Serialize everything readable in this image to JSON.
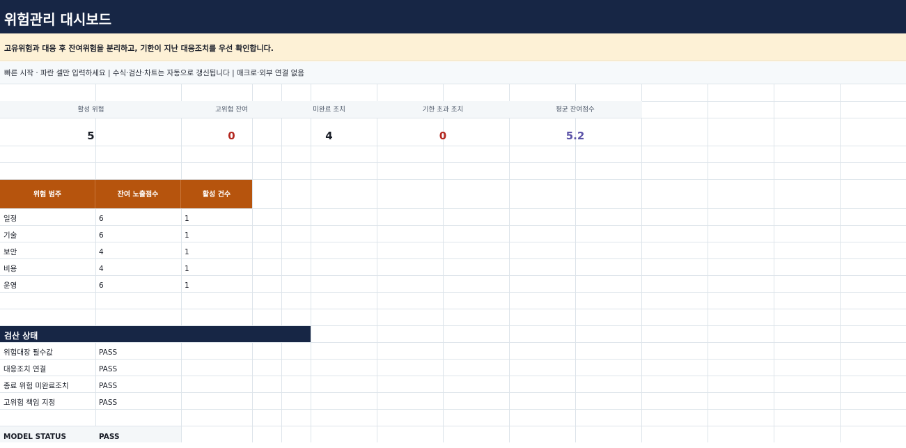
{
  "title": "위험관리 대시보드",
  "note": "고유위험과 대응 후 잔여위험을 분리하고, 기한이 지난 대응조치를 우선 확인합니다.",
  "quick_start": "빠른 시작 · 파란 셀만 입력하세요  |  수식·검산·차트는 자동으로 갱신됩니다  |  매크로·외부 연결 없음",
  "kpis": [
    {
      "label": "활성 위험",
      "value": "5",
      "color": "#1b1f29"
    },
    {
      "label": "고위험 잔여",
      "value": "0",
      "color": "#b3261e"
    },
    {
      "label": "미완료 조치",
      "value": "4",
      "color": "#1b1f29"
    },
    {
      "label": "기한 초과 조치",
      "value": "0",
      "color": "#b3261e"
    },
    {
      "label": "평균 잔여점수",
      "value": "5.2",
      "color": "#5b53a8"
    }
  ],
  "category_table": {
    "headers": [
      "위험 범주",
      "잔여 노출점수",
      "활성 건수"
    ],
    "rows": [
      [
        "일정",
        "6",
        "1"
      ],
      [
        "기술",
        "6",
        "1"
      ],
      [
        "보안",
        "4",
        "1"
      ],
      [
        "비용",
        "4",
        "1"
      ],
      [
        "운영",
        "6",
        "1"
      ]
    ]
  },
  "checks": {
    "title": "검산 상태",
    "rows": [
      [
        "위험대장 필수값",
        "PASS"
      ],
      [
        "대응조치 연결",
        "PASS"
      ],
      [
        "종료 위험 미완료조치",
        "PASS"
      ],
      [
        "고위험 책임 지정",
        "PASS"
      ]
    ]
  },
  "model_status": {
    "label": "MODEL STATUS",
    "value": "PASS"
  }
}
